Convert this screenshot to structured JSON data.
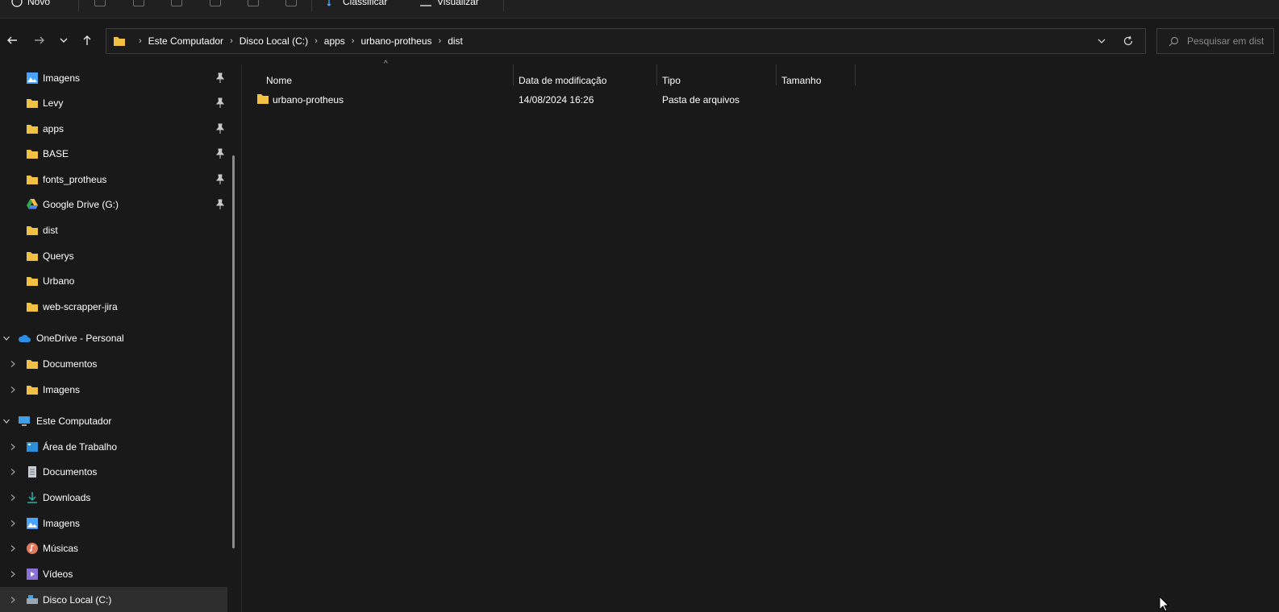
{
  "toolbar": {
    "new_label": "Novo",
    "sort_label": "Classificar",
    "view_label": "Visualizar"
  },
  "nav": {
    "back": "back",
    "forward": "forward",
    "recent": "recent",
    "up": "up"
  },
  "address": {
    "crumbs": [
      "Este Computador",
      "Disco Local (C:)",
      "apps",
      "urbano-protheus",
      "dist"
    ]
  },
  "search": {
    "placeholder": "Pesquisar em dist"
  },
  "sidebar": {
    "quick_access": [
      {
        "label": "Imagens",
        "icon": "pictures-icon",
        "pinned": true
      },
      {
        "label": "Levy",
        "icon": "folder-icon",
        "pinned": true
      },
      {
        "label": "apps",
        "icon": "folder-icon",
        "pinned": true
      },
      {
        "label": "BASE",
        "icon": "folder-icon",
        "pinned": true
      },
      {
        "label": "fonts_protheus",
        "icon": "folder-icon",
        "pinned": true
      },
      {
        "label": "Google Drive (G:)",
        "icon": "google-drive-icon",
        "pinned": true
      },
      {
        "label": "dist",
        "icon": "folder-icon",
        "pinned": false
      },
      {
        "label": "Querys",
        "icon": "folder-icon",
        "pinned": false
      },
      {
        "label": "Urbano",
        "icon": "folder-icon",
        "pinned": false
      },
      {
        "label": "web-scrapper-jira",
        "icon": "folder-icon",
        "pinned": false
      }
    ],
    "onedrive": {
      "label": "OneDrive - Personal",
      "children": [
        "Documentos",
        "Imagens"
      ]
    },
    "this_pc": {
      "label": "Este Computador",
      "children": [
        {
          "label": "Área de Trabalho",
          "icon": "desktop-icon"
        },
        {
          "label": "Documentos",
          "icon": "documents-icon"
        },
        {
          "label": "Downloads",
          "icon": "downloads-icon"
        },
        {
          "label": "Imagens",
          "icon": "pictures-icon"
        },
        {
          "label": "Músicas",
          "icon": "music-icon"
        },
        {
          "label": "Vídeos",
          "icon": "videos-icon"
        },
        {
          "label": "Disco Local (C:)",
          "icon": "drive-icon"
        }
      ]
    }
  },
  "columns": {
    "name": "Nome",
    "modified": "Data de modificação",
    "type": "Tipo",
    "size": "Tamanho"
  },
  "files": [
    {
      "name": "urbano-protheus",
      "modified": "14/08/2024 16:26",
      "type": "Pasta de arquivos",
      "size": ""
    }
  ],
  "colors": {
    "background": "#191919",
    "folder": "#f2c043",
    "accent": "#4aa3ff"
  }
}
